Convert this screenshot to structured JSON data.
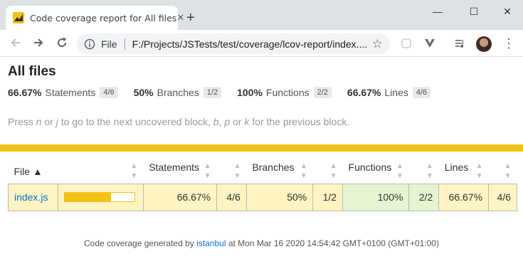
{
  "browser": {
    "tab_title": "Code coverage report for All files",
    "tab_close": "✕",
    "new_tab": "+",
    "scheme_label": "File",
    "url": "F:/Projects/JSTests/test/coverage/lcov-report/index....",
    "win_min": "—",
    "win_max": "☐",
    "win_close": "✕"
  },
  "report": {
    "title": "All files",
    "summary": [
      {
        "pct": "66.67%",
        "label": "Statements",
        "fraction": "4/6"
      },
      {
        "pct": "50%",
        "label": "Branches",
        "fraction": "1/2"
      },
      {
        "pct": "100%",
        "label": "Functions",
        "fraction": "2/2"
      },
      {
        "pct": "66.67%",
        "label": "Lines",
        "fraction": "4/6"
      }
    ],
    "hint": {
      "press": "Press ",
      "k1": "n",
      "or1": " or ",
      "k2": "j",
      "mid": " to go to the next uncovered block, ",
      "k3": "b",
      "comma": ", ",
      "k4": "p",
      "or2": " or ",
      "k5": "k",
      "end": " for the previous block."
    },
    "table": {
      "headers": {
        "file": "File ▲",
        "statements": "Statements",
        "branches": "Branches",
        "functions": "Functions",
        "lines": "Lines"
      },
      "rows": [
        {
          "file": "index.js",
          "statements_pct": "66.67%",
          "statements_frac": "4/6",
          "branches_pct": "50%",
          "branches_frac": "1/2",
          "functions_pct": "100%",
          "functions_frac": "2/2",
          "lines_pct": "66.67%",
          "lines_frac": "4/6",
          "bar_fill": 0.6667
        }
      ]
    },
    "footer": {
      "prefix": "Code coverage generated by ",
      "link": "istanbul",
      "suffix": " at Mon Mar 16 2020 14:54:42 GMT+0100 (GMT+01:00)"
    },
    "colors": {
      "medium": "#fff4c2",
      "high": "#e6f5d0",
      "status_bar": "#f2c314",
      "link": "#0074d9"
    }
  }
}
